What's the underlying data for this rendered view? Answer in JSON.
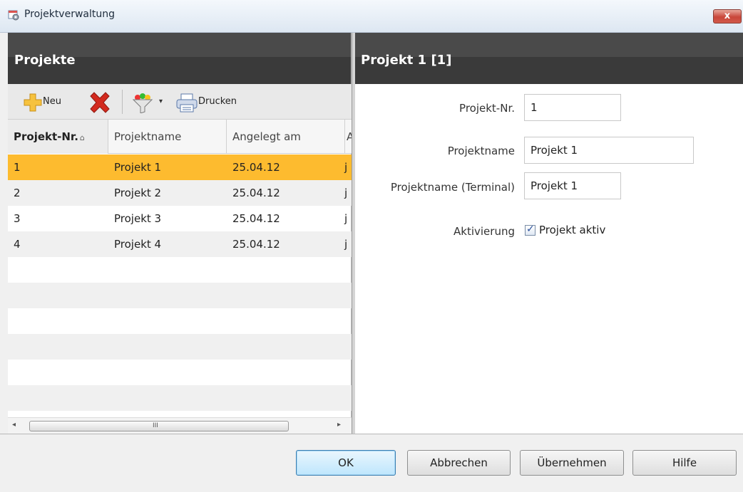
{
  "window": {
    "title": "Projektverwaltung",
    "close_glyph": "x",
    "app_icon": "calendar-gear-icon"
  },
  "left_panel": {
    "header": "Projekte",
    "toolbar": {
      "new_label": "Neu",
      "delete_icon": "delete-x-icon",
      "filter_icon": "filter-funnel-icon",
      "dropdown_glyph": "▾",
      "print_label": "Drucken"
    },
    "grid": {
      "columns": [
        "Projekt-Nr.",
        "Projektname",
        "Angelegt am",
        "A"
      ],
      "sort_glyph": "⌂",
      "rows": [
        {
          "nr": "1",
          "name": "Projekt 1",
          "date": "25.04.12",
          "extra": "j"
        },
        {
          "nr": "2",
          "name": "Projekt 2",
          "date": "25.04.12",
          "extra": "j"
        },
        {
          "nr": "3",
          "name": "Projekt 3",
          "date": "25.04.12",
          "extra": "j"
        },
        {
          "nr": "4",
          "name": "Projekt 4",
          "date": "25.04.12",
          "extra": "j"
        }
      ],
      "selected_row": 0
    },
    "scrollbar": {
      "left_arrow": "◂",
      "right_arrow": "▸",
      "grip": "III"
    }
  },
  "right_panel": {
    "header": "Projekt 1 [1]",
    "form": {
      "nr_label": "Projekt-Nr.",
      "nr_value": "1",
      "name_label": "Projektname",
      "name_value": "Projekt 1",
      "terminal_label": "Projektname (Terminal)",
      "terminal_value": "Projekt 1",
      "activation_label": "Aktivierung",
      "active_checkbox_label": "Projekt aktiv",
      "active_checked": true
    }
  },
  "buttons": {
    "ok": "OK",
    "cancel": "Abbrechen",
    "apply": "Übernehmen",
    "help": "Hilfe"
  },
  "colors": {
    "header_bg": "#3a3a3a",
    "selection": "#fdbb2f",
    "default_button": "#bee6fd"
  }
}
